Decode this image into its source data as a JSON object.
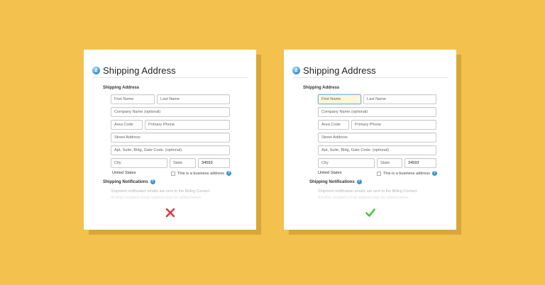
{
  "colors": {
    "background": "#f2c14e",
    "error": "#e0383e",
    "success": "#4cc23c",
    "focus": "#7fb4e0"
  },
  "cards": [
    {
      "step": "2",
      "title": "Shipping Address",
      "section_label": "Shipping Address",
      "fields": {
        "first_name": "First Name",
        "last_name": "Last Name",
        "company": "Company Name (optional)",
        "area_code": "Area Code",
        "phone": "Primary Phone",
        "street": "Street Address",
        "apt": "Apt, Suite, Bldg, Gate Code. (optional)",
        "city": "City",
        "state": "State",
        "zip": "34593"
      },
      "country": "United States",
      "business_label": "This is a business address",
      "notifications_label": "Shipping Notifications",
      "notification_line1": "Shipment notification emails are sent to the Billing Contact.",
      "notification_line2": "Another recipient email address may be added below.",
      "verdict_icon": "x-icon"
    },
    {
      "step": "2",
      "title": "Shipping Address",
      "section_label": "Shipping Address",
      "fields": {
        "first_name": "First Name",
        "last_name": "Last Name",
        "company": "Company Name (optional)",
        "area_code": "Area Code",
        "phone": "Primary Phone",
        "street": "Street Address",
        "apt": "Apt, Suite, Bldg, Gate Code. (optional)",
        "city": "City",
        "state": "State",
        "zip": "34593"
      },
      "country": "United States",
      "business_label": "This is a business address",
      "notifications_label": "Shipping Notifications",
      "notification_line1": "Shipment notification emails are sent to the Billing Contact.",
      "notification_line2": "Another recipient email address may be added below.",
      "verdict_icon": "check-icon"
    }
  ]
}
